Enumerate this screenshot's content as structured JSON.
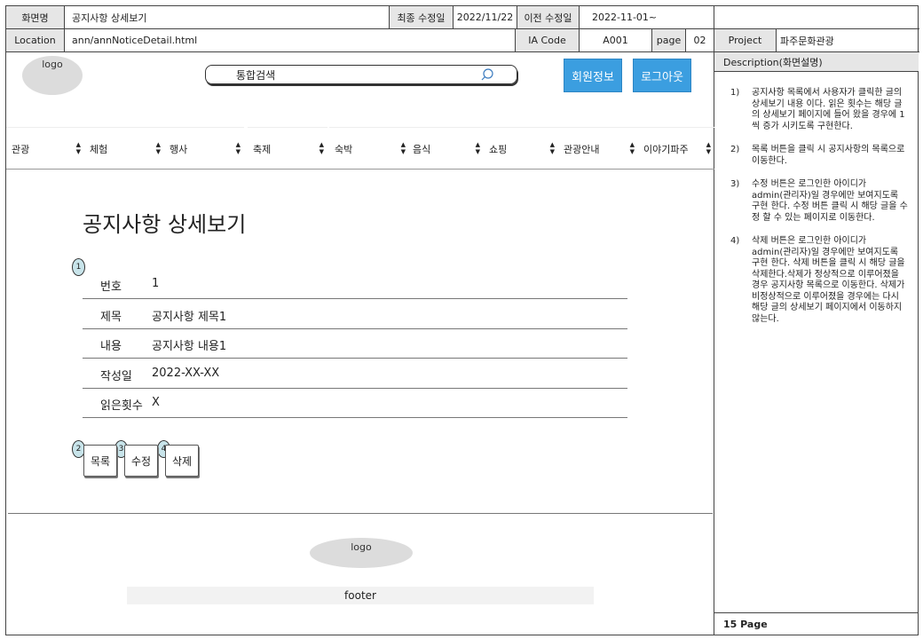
{
  "meta": {
    "screen_name_label": "화면명",
    "screen_name": "공지사항 상세보기",
    "last_modified_label": "최종 수정일",
    "last_modified": "2022/11/22",
    "prev_modified_label": "이전 수정일",
    "prev_modified": "2022-11-01~",
    "location_label": "Location",
    "location": "ann/annNoticeDetail.html",
    "ia_code_label": "IA Code",
    "ia_code": "A001",
    "page_label": "page",
    "page": "02",
    "project_label": "Project",
    "project": "파주문화관광"
  },
  "header": {
    "logo": "logo",
    "search_placeholder": "통합검색",
    "member_info": "회원정보",
    "logout": "로그아웃"
  },
  "nav": {
    "items": [
      {
        "label": "관광"
      },
      {
        "label": "체험"
      },
      {
        "label": "행사"
      },
      {
        "label": "축제"
      },
      {
        "label": "숙박"
      },
      {
        "label": "음식"
      },
      {
        "label": "쇼핑"
      },
      {
        "label": "관광안내"
      },
      {
        "label": "이야기파주"
      }
    ]
  },
  "main": {
    "title": "공지사항 상세보기",
    "rows": [
      {
        "label": "번호",
        "value": "1"
      },
      {
        "label": "제목",
        "value": "공지사항 제목1"
      },
      {
        "label": "내용",
        "value": "공지사항 내용1"
      },
      {
        "label": "작성일",
        "value": "2022-XX-XX"
      },
      {
        "label": "읽은횟수",
        "value": "X"
      }
    ],
    "badges": [
      "1",
      "2",
      "3",
      "4"
    ],
    "buttons": {
      "list": "목록",
      "edit": "수정",
      "delete": "삭제"
    }
  },
  "footer": {
    "logo": "logo",
    "text": "footer"
  },
  "side": {
    "header": "Description(화면설명)",
    "items": [
      {
        "num": "1)",
        "text": "공지사항 목록에서 사용자가 클릭한 글의 상세보기 내용 이다. 읽은 횟수는 해당 글의 상세보기 페이지에 들어 왔을 경우에 1씩 증가 시키도록 구현한다."
      },
      {
        "num": "2)",
        "text": "목록 버튼을 클릭 시 공지사항의 목록으로 이동한다."
      },
      {
        "num": "3)",
        "text": "수정 버튼은 로그인한 아이디가 admin(관리자)일 경우에만 보여지도록 구현 한다. 수정 버튼 클릭 시 해당 글을 수정 할 수 있는 페이지로 이동한다."
      },
      {
        "num": "4)",
        "text": "삭제 버튼은 로그인한 아이디가 admin(관리자)일 경우에만 보여지도록 구현 한다. 삭제 버튼을 클릭 시 해당 글을 삭제한다.삭제가 정상적으로 이루어졌을 경우 공지사항 목록으로 이동한다. 삭제가 비정상적으로 이루어졌을 경우에는 다시 해당 글의 상세보기 페이지에서 이동하지 않는다."
      }
    ],
    "footer": "15 Page"
  }
}
